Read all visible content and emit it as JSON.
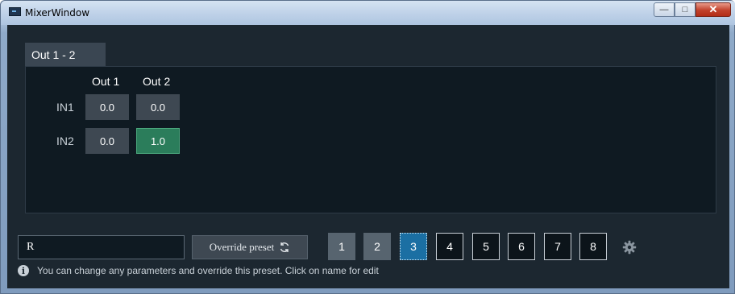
{
  "window": {
    "title": "MixerWindow"
  },
  "tab": {
    "label": "Out 1 - 2"
  },
  "matrix": {
    "columns": [
      "Out 1",
      "Out 2"
    ],
    "rows": [
      {
        "label": "IN1",
        "values": [
          "0.0",
          "0.0"
        ]
      },
      {
        "label": "IN2",
        "values": [
          "0.0",
          "1.0"
        ]
      }
    ],
    "active_cell": "IN2/Out 2"
  },
  "preset": {
    "name_value": "R",
    "override_label": "Override preset",
    "buttons": [
      "1",
      "2",
      "3",
      "4",
      "5",
      "6",
      "7",
      "8"
    ],
    "selected": "3"
  },
  "info": {
    "text": "You can change any parameters and override this preset. Click on name for edit"
  },
  "colors": {
    "background": "#1c2730",
    "panel": "#0f1a22",
    "cell": "#3e4852",
    "active_cell": "#2b7d5b",
    "selected_preset": "#1b6fa3"
  },
  "icons": {
    "refresh": "refresh-icon",
    "gear": "gear-icon",
    "info": "info-icon"
  }
}
